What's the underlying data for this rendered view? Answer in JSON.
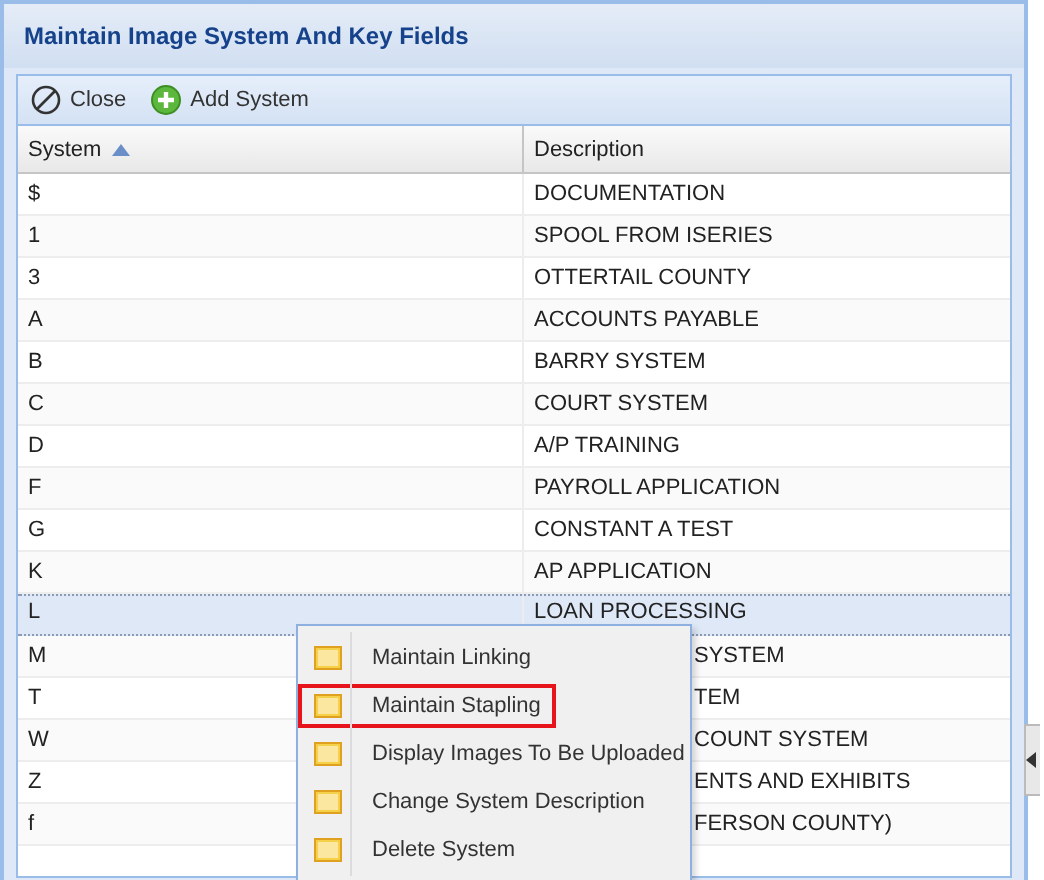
{
  "window": {
    "title": "Maintain Image System And Key Fields"
  },
  "toolbar": [
    {
      "kind": "close",
      "label": "Close"
    },
    {
      "kind": "add",
      "label": "Add System"
    }
  ],
  "table": {
    "columns": [
      {
        "label": "System",
        "sorted": true
      },
      {
        "label": "Description",
        "sorted": false
      }
    ],
    "rows": [
      {
        "system": "$",
        "description": "DOCUMENTATION",
        "selected": false,
        "under_menu": false
      },
      {
        "system": "1",
        "description": "SPOOL FROM ISERIES",
        "selected": false,
        "under_menu": false
      },
      {
        "system": "3",
        "description": "OTTERTAIL COUNTY",
        "selected": false,
        "under_menu": false
      },
      {
        "system": "A",
        "description": "ACCOUNTS PAYABLE",
        "selected": false,
        "under_menu": false
      },
      {
        "system": "B",
        "description": "BARRY SYSTEM",
        "selected": false,
        "under_menu": false
      },
      {
        "system": "C",
        "description": "COURT SYSTEM",
        "selected": false,
        "under_menu": false
      },
      {
        "system": "D",
        "description": "A/P TRAINING",
        "selected": false,
        "under_menu": false
      },
      {
        "system": "F",
        "description": "PAYROLL APPLICATION",
        "selected": false,
        "under_menu": false
      },
      {
        "system": "G",
        "description": "CONSTANT A TEST",
        "selected": false,
        "under_menu": false
      },
      {
        "system": "K",
        "description": "AP APPLICATION",
        "selected": false,
        "under_menu": false
      },
      {
        "system": "L",
        "description": "LOAN PROCESSING",
        "selected": true,
        "under_menu": false
      },
      {
        "system": "M",
        "description": "SYSTEM",
        "selected": false,
        "under_menu": true
      },
      {
        "system": "T",
        "description": "TEM",
        "selected": false,
        "under_menu": true
      },
      {
        "system": "W",
        "description": "COUNT SYSTEM",
        "selected": false,
        "under_menu": true
      },
      {
        "system": "Z",
        "description": "ENTS AND EXHIBITS",
        "selected": false,
        "under_menu": true
      },
      {
        "system": "f",
        "description": "FERSON COUNTY)",
        "selected": false,
        "under_menu": true
      }
    ]
  },
  "context_menu": {
    "items": [
      {
        "label": "Maintain Linking",
        "highlighted": false
      },
      {
        "label": "Maintain Stapling",
        "highlighted": true
      },
      {
        "label": "Display Images To Be Uploaded",
        "highlighted": false
      },
      {
        "label": "Change System Description",
        "highlighted": false
      },
      {
        "label": "Delete System",
        "highlighted": false
      }
    ]
  }
}
